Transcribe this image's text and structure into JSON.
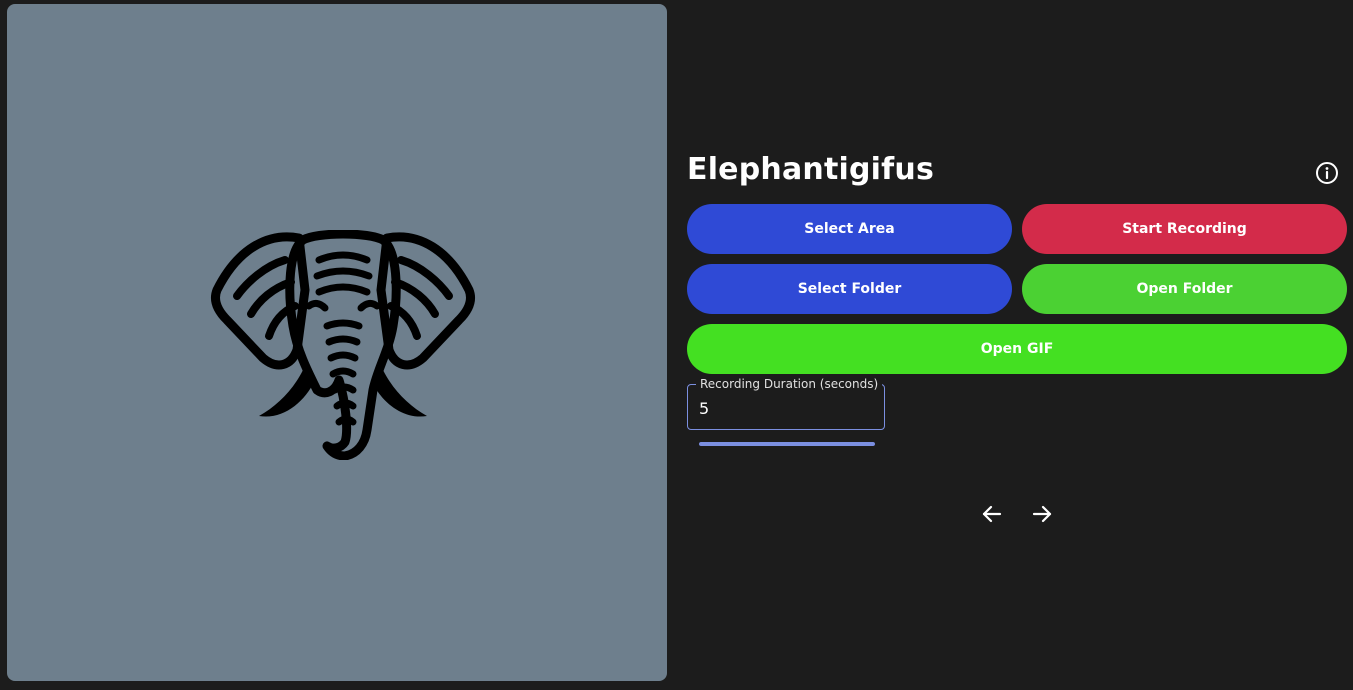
{
  "app": {
    "title": "Elephantigifus"
  },
  "buttons": {
    "select_area": "Select Area",
    "start_recording": "Start Recording",
    "select_folder": "Select Folder",
    "open_folder": "Open Folder",
    "open_gif": "Open GIF"
  },
  "colors": {
    "background": "#1c1c1c",
    "preview_bg": "#6e7f8d",
    "select_blue": "#2f4ad6",
    "record_red": "#d32b4a",
    "open_folder_green": "#4bd133",
    "open_gif_green": "#44e022",
    "accent": "#7b8fe0"
  },
  "duration": {
    "label": "Recording Duration (seconds)",
    "value": "5"
  },
  "progress": {
    "fraction": 1.0
  },
  "icons": {
    "info": "info-circle-icon",
    "prev": "arrow-left-icon",
    "next": "arrow-right-icon",
    "preview": "elephant-logo"
  }
}
